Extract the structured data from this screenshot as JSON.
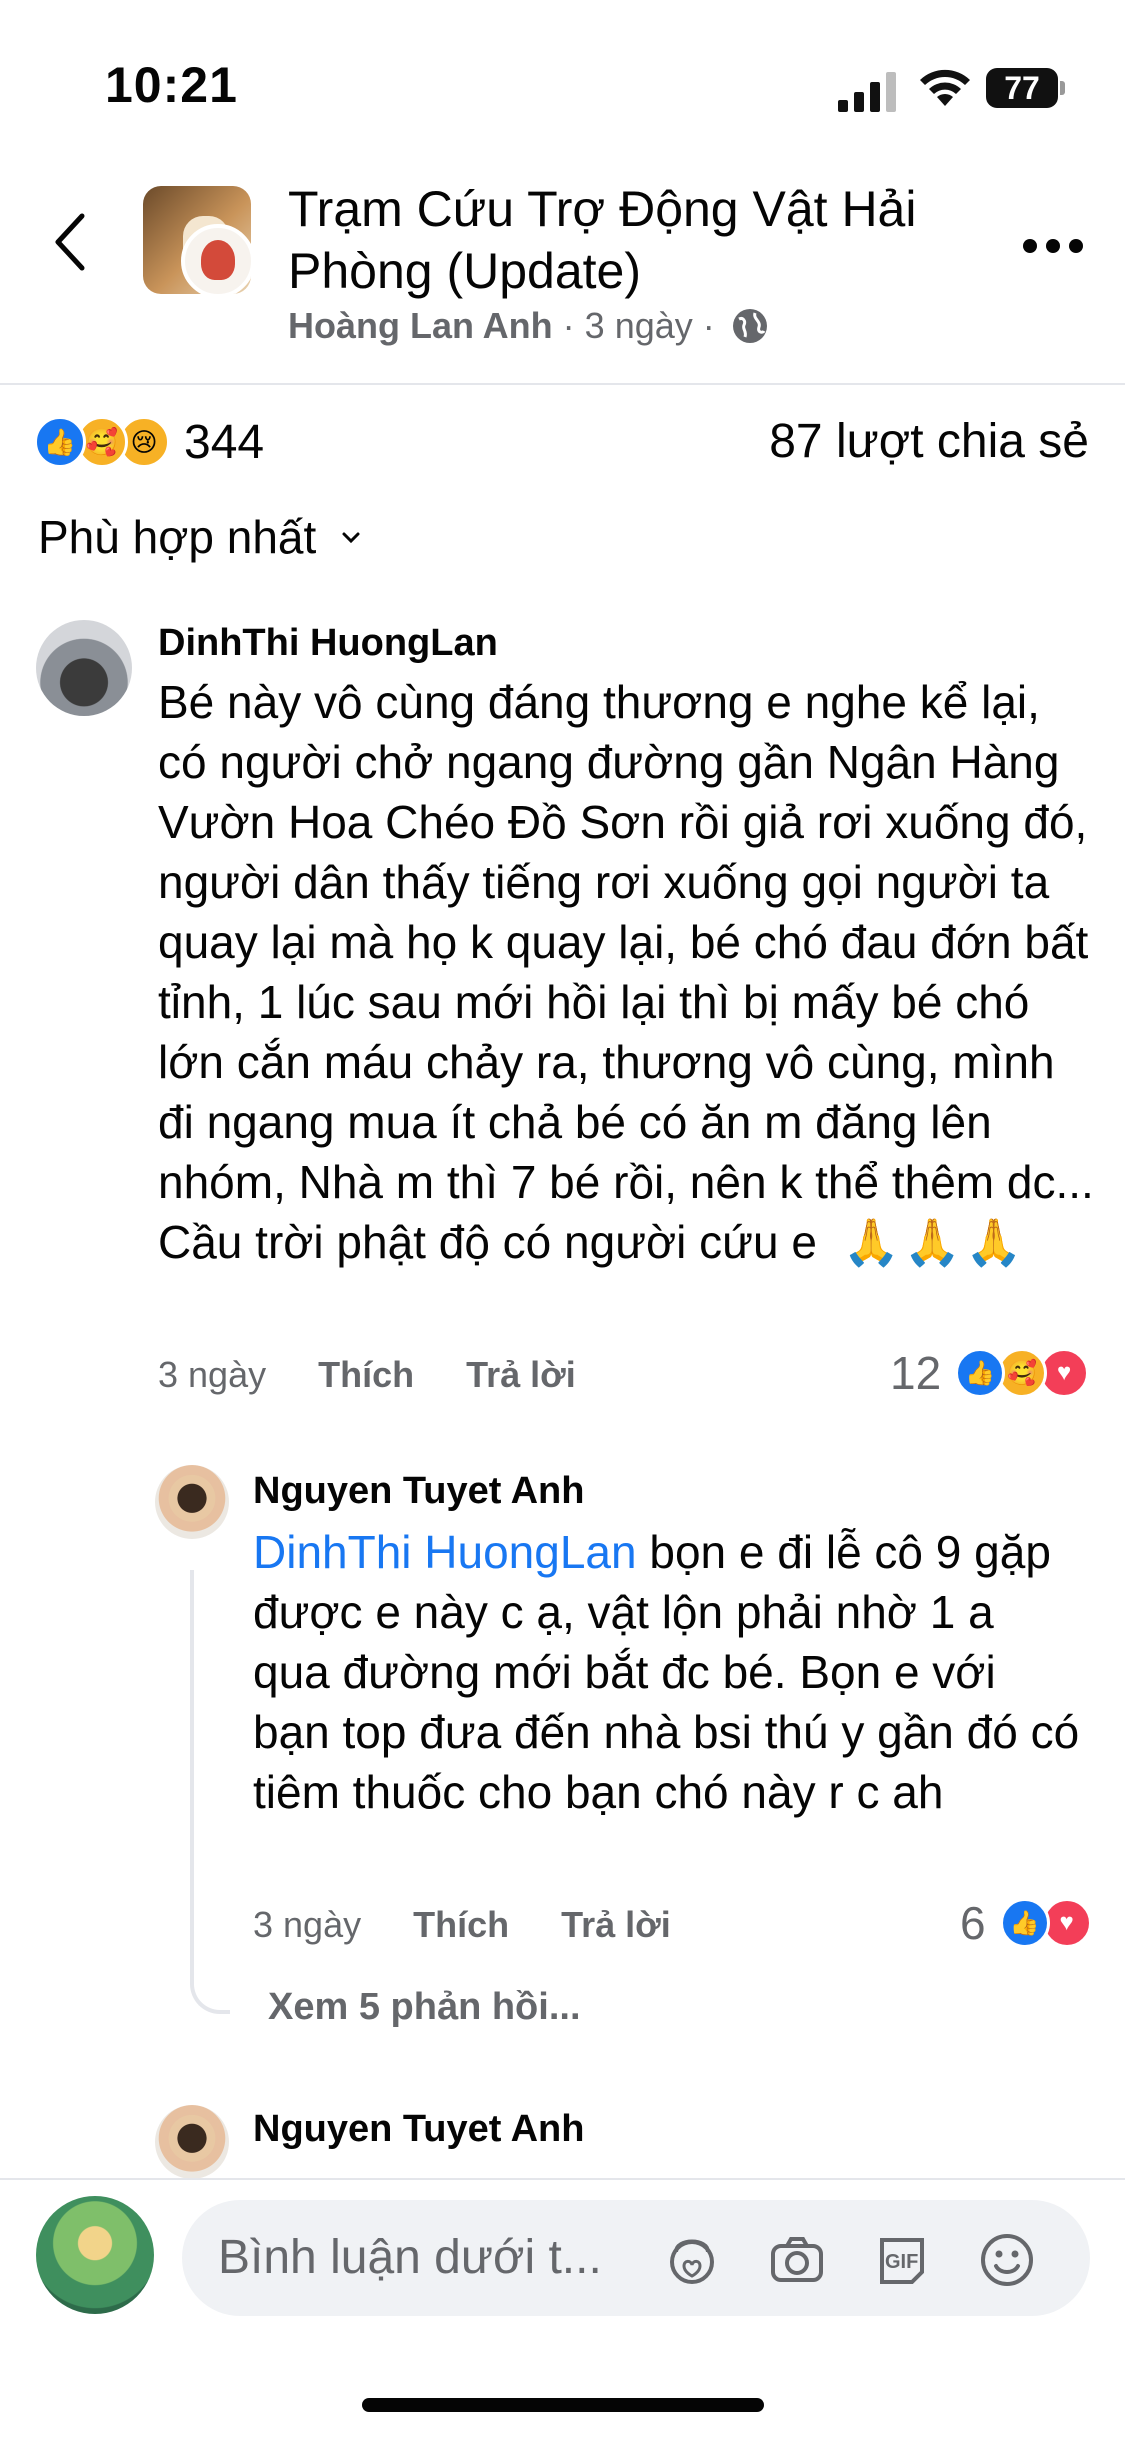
{
  "status_bar": {
    "time": "10:21",
    "battery": "77"
  },
  "header": {
    "title": "Trạm Cứu Trợ Động Vật Hải Phòng (Update)",
    "author": "Hoàng Lan Anh",
    "time": "3 ngày",
    "separator": "·"
  },
  "reactions": {
    "count": "344",
    "shares": "87 lượt chia sẻ"
  },
  "sort": {
    "label": "Phù hợp nhất"
  },
  "comments": [
    {
      "name": "DinhThi HuongLan",
      "text": "Bé này vô cùng đáng thương e nghe kể lại, có người chở ngang đường gần Ngân Hàng Vườn Hoa Chéo Đồ Sơn rồi giả rơi xuống đó, người dân thấy tiếng rơi xuống gọi người ta quay lại mà họ k quay lại, bé chó đau đớn bất tỉnh, 1 lúc sau mới hồi lại thì bị mấy bé chó lớn cắn máu chảy ra, thương vô cùng, mình đi ngang mua ít chả bé có ăn m đăng lên nhóm, Nhà m thì 7 bé rồi, nên k thể thêm dc... Cầu trời phật độ có người cứu e",
      "emoji": "🙏🙏🙏",
      "time": "3 ngày",
      "like": "Thích",
      "reply": "Trả lời",
      "reaction_count": "12"
    },
    {
      "name": "Nguyen Tuyet Anh",
      "mention": "DinhThi HuongLan",
      "text": "bọn e đi lễ cô 9 gặp được e này c ạ, vật lộn phải nhờ 1 a qua đường mới bắt đc bé. Bọn e với bạn top đưa đến nhà bsi thú y gần đó có tiêm thuốc cho bạn chó này r c ah",
      "time": "3 ngày",
      "like": "Thích",
      "reply": "Trả lời",
      "reaction_count": "6"
    },
    {
      "name": "Nguyen Tuyet Anh"
    }
  ],
  "view_replies": "Xem 5 phản hồi...",
  "composer": {
    "placeholder": "Bình luận dưới t..."
  }
}
